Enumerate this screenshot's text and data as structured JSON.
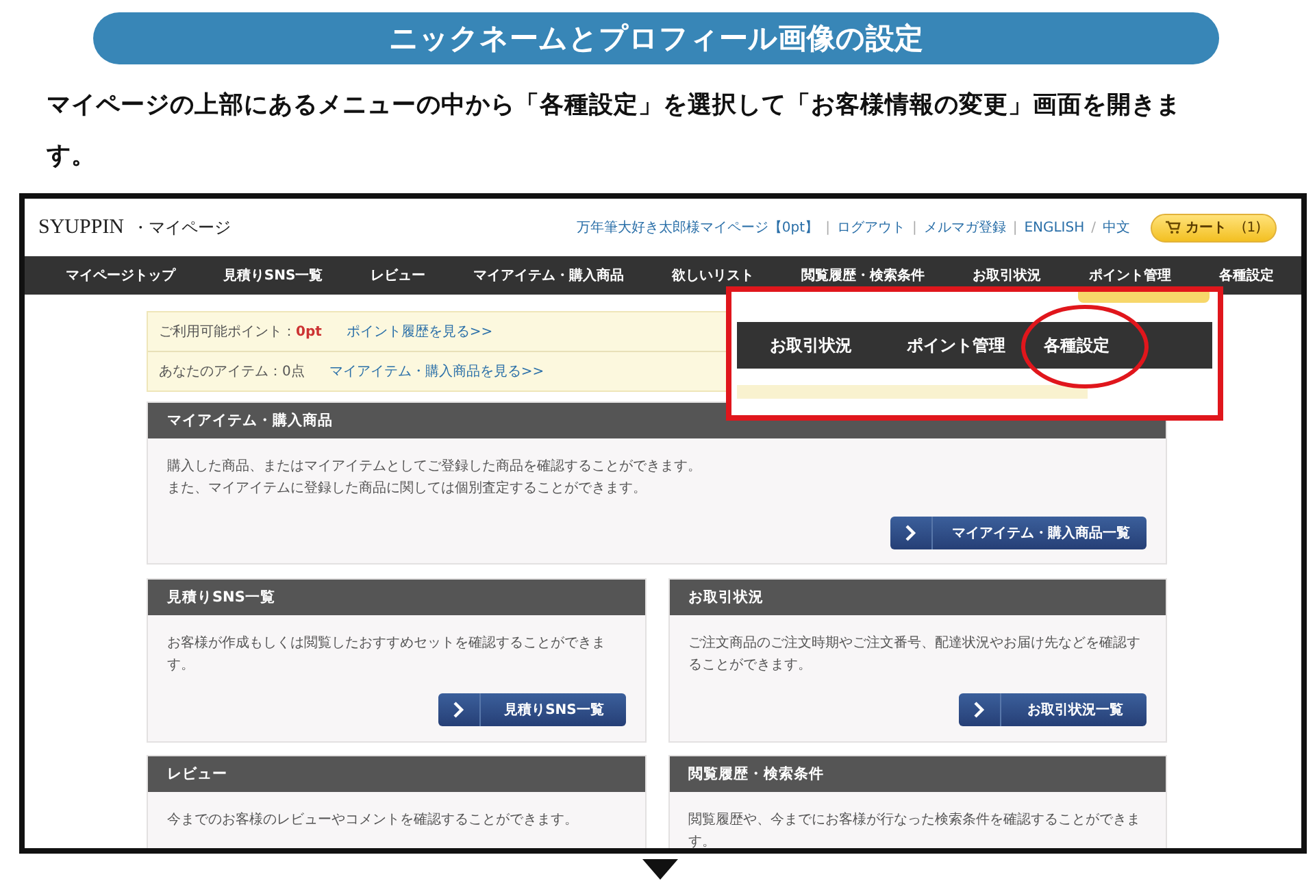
{
  "title": "ニックネームとプロフィール画像の設定",
  "instruction": "マイページの上部にあるメニューの中から「各種設定」を選択して「お客様情報の変更」画面を開きます。",
  "screenshot": {
    "logo": {
      "brand": "SYUPPIN",
      "suffix": "・マイページ"
    },
    "header_links": [
      {
        "label": "万年筆大好き太郎様マイページ【0pt】",
        "sep": "|"
      },
      {
        "label": "ログアウト",
        "sep": "|"
      },
      {
        "label": "メルマガ登録",
        "sep": "|"
      },
      {
        "label": "ENGLISH",
        "sep": "/"
      },
      {
        "label": "中文"
      }
    ],
    "cart": {
      "label": "カート",
      "count": "(1)"
    },
    "nav": [
      "マイページトップ",
      "見積りSNS一覧",
      "レビュー",
      "マイアイテム・購入商品",
      "欲しいリスト",
      "閲覧履歴・検索条件",
      "お取引状況",
      "ポイント管理",
      "各種設定"
    ],
    "summary": [
      {
        "label": "ご利用可能ポイント：",
        "value": "0pt",
        "link": "ポイント履歴を見る>>",
        "kind": "points"
      },
      {
        "label": "あなたのアイテム：",
        "value": "0点",
        "link": "マイアイテム・購入商品を見る>>",
        "kind": "items"
      }
    ],
    "main_card": {
      "title": "マイアイテム・購入商品",
      "lines": [
        "購入した商品、またはマイアイテムとしてご登録した商品を確認することができます。",
        "また、マイアイテムに登録した商品に関しては個別査定することができます。"
      ],
      "button": "マイアイテム・購入商品一覧"
    },
    "cards": [
      {
        "title": "見積りSNS一覧",
        "text": "お客様が作成もしくは閲覧したおすすめセットを確認することができます。",
        "button": "見積りSNS一覧"
      },
      {
        "title": "お取引状況",
        "text": "ご注文商品のご注文時期やご注文番号、配達状況やお届け先などを確認することができます。",
        "button": "お取引状況一覧"
      },
      {
        "title": "レビュー",
        "text": "今までのお客様のレビューやコメントを確認することができます。"
      },
      {
        "title": "閲覧履歴・検索条件",
        "text": "閲覧履歴や、今までにお客様が行なった検索条件を確認することができます。"
      }
    ],
    "callout": {
      "items": [
        {
          "label": "お取引状況",
          "circled": false
        },
        {
          "label": "ポイント管理",
          "circled": false
        },
        {
          "label": "各種設定",
          "circled": true
        }
      ]
    }
  }
}
